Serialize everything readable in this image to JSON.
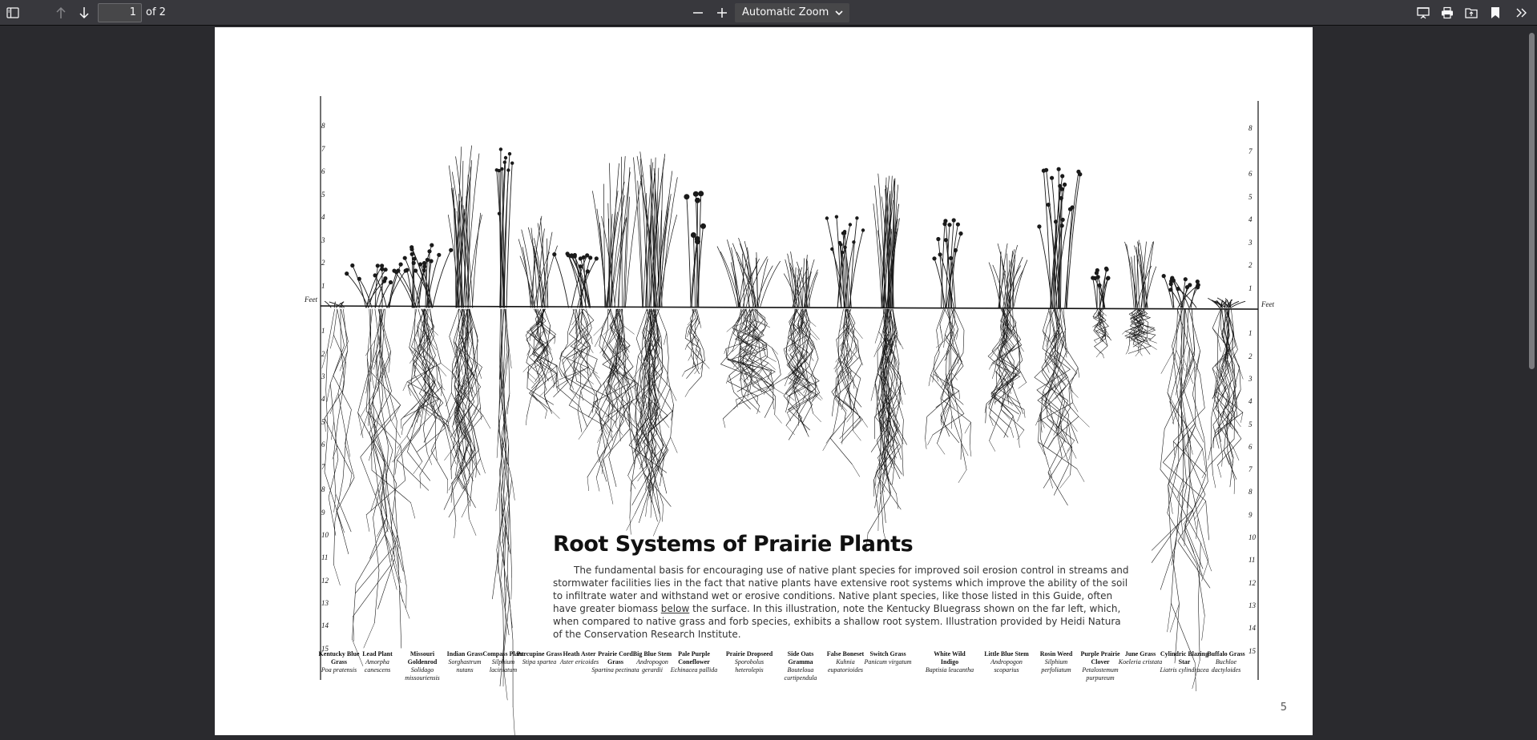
{
  "toolbar": {
    "page_number": "1",
    "page_count": "of 2",
    "zoom": "Automatic Zoom",
    "icons": {
      "sidebar": "sidebar-toggle-icon",
      "prev": "arrow-up-icon",
      "next": "arrow-down-icon",
      "zoom_out": "minus-icon",
      "zoom_in": "plus-icon",
      "presentation": "presentation-mode-icon",
      "print": "print-icon",
      "open": "open-file-icon",
      "bookmark": "bookmark-icon",
      "more": "double-chevron-right-icon"
    }
  },
  "document": {
    "title": "Root Systems of Prairie Plants",
    "body_before": "The fundamental basis for encouraging use of native plant species for improved soil erosion control in streams and stormwater facilities lies in the fact that native plants have extensive root systems which improve the ability of the soil to infiltrate water and withstand wet or erosive conditions. Native plant species, like those listed in this Guide, often have greater biomass ",
    "body_underlined": "below",
    "body_after": " the surface. In this illustration, note the Kentucky Bluegrass shown on the far left, which, when compared to native grass and forb species, exhibits a shallow root system. Illustration provided by Heidi Natura of the Conservation Research Institute.",
    "page_number": "5",
    "scale_label": "Feet",
    "scale_above": [
      "8",
      "7",
      "6",
      "5",
      "4",
      "3",
      "2",
      "1"
    ],
    "scale_below": [
      "1",
      "2",
      "3",
      "4",
      "5",
      "6",
      "7",
      "8",
      "9",
      "10",
      "11",
      "12",
      "13",
      "14",
      "15"
    ],
    "plants": [
      {
        "common": "Kentucky Blue Grass",
        "scientific": "Poa pratensis"
      },
      {
        "common": "Lead Plant",
        "scientific": "Amorpha canescens"
      },
      {
        "common": "Missouri Goldenrod",
        "scientific": "Solidago missouriensis"
      },
      {
        "common": "Indian Grass",
        "scientific": "Sorghastrum nutans"
      },
      {
        "common": "Compass Plant",
        "scientific": "Silphium laciniatum"
      },
      {
        "common": "Porcupine Grass",
        "scientific": "Stipa spartea"
      },
      {
        "common": "Heath Aster",
        "scientific": "Aster ericoides"
      },
      {
        "common": "Prairie Cord Grass",
        "scientific": "Spartina pectinata"
      },
      {
        "common": "Big Blue Stem",
        "scientific": "Andropogon gerardii"
      },
      {
        "common": "Pale Purple Coneflower",
        "scientific": "Echinacea pallida"
      },
      {
        "common": "Prairie Dropseed",
        "scientific": "Sporobolus heterolepis"
      },
      {
        "common": "Side Oats Gramma",
        "scientific": "Bouteloua curtipendula"
      },
      {
        "common": "False Boneset",
        "scientific": "Kuhnia eupatorioides"
      },
      {
        "common": "Switch Grass",
        "scientific": "Panicum virgatum"
      },
      {
        "common": "White Wild Indigo",
        "scientific": "Baptisia leucantha"
      },
      {
        "common": "Little Blue Stem",
        "scientific": "Andropogon scoparius"
      },
      {
        "common": "Rosin Weed",
        "scientific": "Silphium perfoliatum"
      },
      {
        "common": "Purple Prairie Clover",
        "scientific": "Petalostemum purpureum"
      },
      {
        "common": "June Grass",
        "scientific": "Koeleria cristata"
      },
      {
        "common": "Cylindric Blazing Star",
        "scientific": "Liatris cylindracea"
      },
      {
        "common": "Buffalo Grass",
        "scientific": "Buchloe dactyloides"
      }
    ]
  }
}
